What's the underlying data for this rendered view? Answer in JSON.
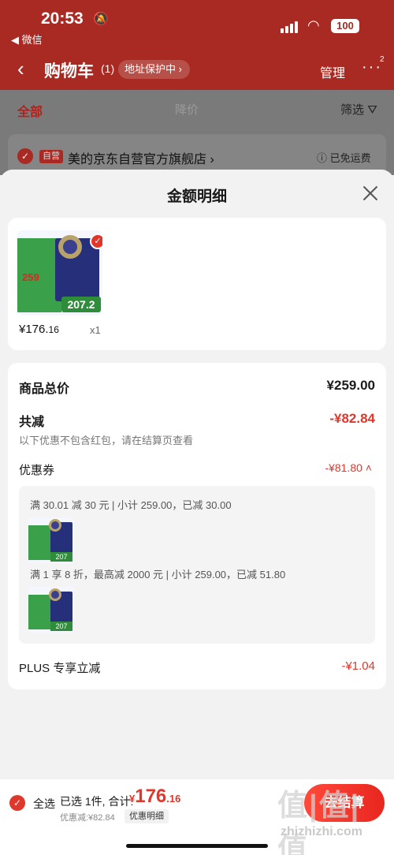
{
  "status_bar": {
    "time": "20:53",
    "back_app": "◀ 微信",
    "battery": "100"
  },
  "header": {
    "title": "购物车",
    "count": "(1)",
    "address_chip": "地址保护中 ›",
    "manage": "管理",
    "more_badge": "2"
  },
  "tabs": {
    "all": "全部",
    "price_drop": "降价",
    "filter": "筛选"
  },
  "shop": {
    "badge": "自营",
    "name": "美的京东自营官方旗舰店 ›",
    "shipping": "ⓘ 已免运费"
  },
  "modal": {
    "title": "金额明细",
    "item": {
      "price_main": "¥176.",
      "price_cents": "16",
      "qty": "x1",
      "thumb_price_a": "259",
      "thumb_price_b": "207.2"
    },
    "total_label": "商品总价",
    "total_value": "¥259.00",
    "reduce_label": "共减",
    "reduce_value": "-¥82.84",
    "reduce_note": "以下优惠不包含红包，请在结算页查看",
    "coupon_label": "优惠券",
    "coupon_value": "-¥81.80 ˄",
    "rules": [
      "满 30.01 减 30 元 | 小计 259.00，已减 30.00",
      "满 1 享 8 折，最高减 2000 元 | 小计 259.00，已减 51.80"
    ],
    "mini_price": "207",
    "plus_label": "PLUS 专享立减",
    "plus_value": "-¥1.04"
  },
  "bottom": {
    "select_all": "全选",
    "selected": "已选 1件, 合计:",
    "amount_cur": "¥",
    "amount_int": "176",
    "amount_dec": ".16",
    "discount": "优惠减:¥82.84",
    "detail_btn": "优惠明细",
    "checkout": "去结算",
    "watermark": "值|值|值",
    "watermark_url": "zhizhizhi.com"
  },
  "colors": {
    "header_red": "#a82a22",
    "price_red": "#e0372c"
  }
}
